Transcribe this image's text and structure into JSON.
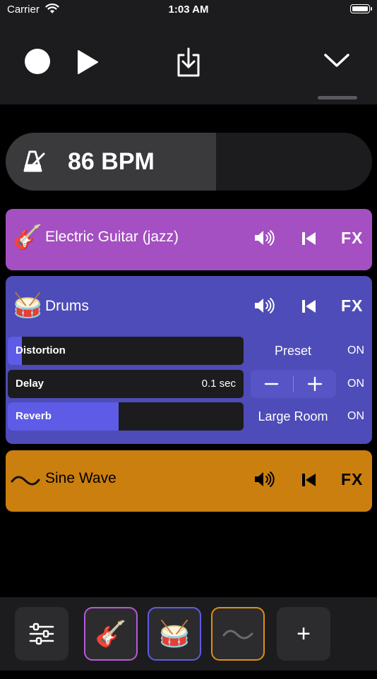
{
  "status_bar": {
    "carrier": "Carrier",
    "time": "1:03 AM",
    "wifi_icon": "wifi-icon",
    "battery_icon": "battery-icon"
  },
  "toolbar": {
    "record_icon": "record-icon",
    "play_icon": "play-icon",
    "export_icon": "export-icon",
    "collapse_icon": "chevron-down-icon"
  },
  "tempo": {
    "icon": "metronome-icon",
    "label": "86 BPM",
    "level": 0.575
  },
  "tracks": {
    "guitar": {
      "emoji": "🎸",
      "name": "Electric Guitar (jazz)",
      "fx_label": "FX",
      "color": "#a44fc2"
    },
    "drums": {
      "emoji": "🥁",
      "name": "Drums",
      "fx_label": "FX",
      "color": "#4e4cb8",
      "effects": [
        {
          "name": "Distortion",
          "value": "",
          "level": 0.06,
          "aux": "Preset",
          "state": "ON"
        },
        {
          "name": "Delay",
          "value": "0.1 sec",
          "level": 0.0,
          "aux": "",
          "state": "ON"
        },
        {
          "name": "Reverb",
          "value": "",
          "level": 0.47,
          "aux": "Large Room",
          "state": "ON"
        }
      ],
      "stepper": {
        "minus": "−",
        "plus": "+"
      }
    },
    "sine": {
      "emoji": "〰",
      "name": "Sine Wave",
      "fx_label": "FX",
      "color": "#cb7f0e"
    }
  },
  "bottom_bar": {
    "mixer_icon": "sliders-icon",
    "guitar_emoji": "🎸",
    "drums_emoji": "🥁",
    "sine_emoji": "〰",
    "add_label": "+"
  },
  "colors": {
    "accent": "#5e5ce6",
    "guitar": "#b759d6",
    "drums": "#5e5ce6",
    "sine": "#e0900f"
  }
}
